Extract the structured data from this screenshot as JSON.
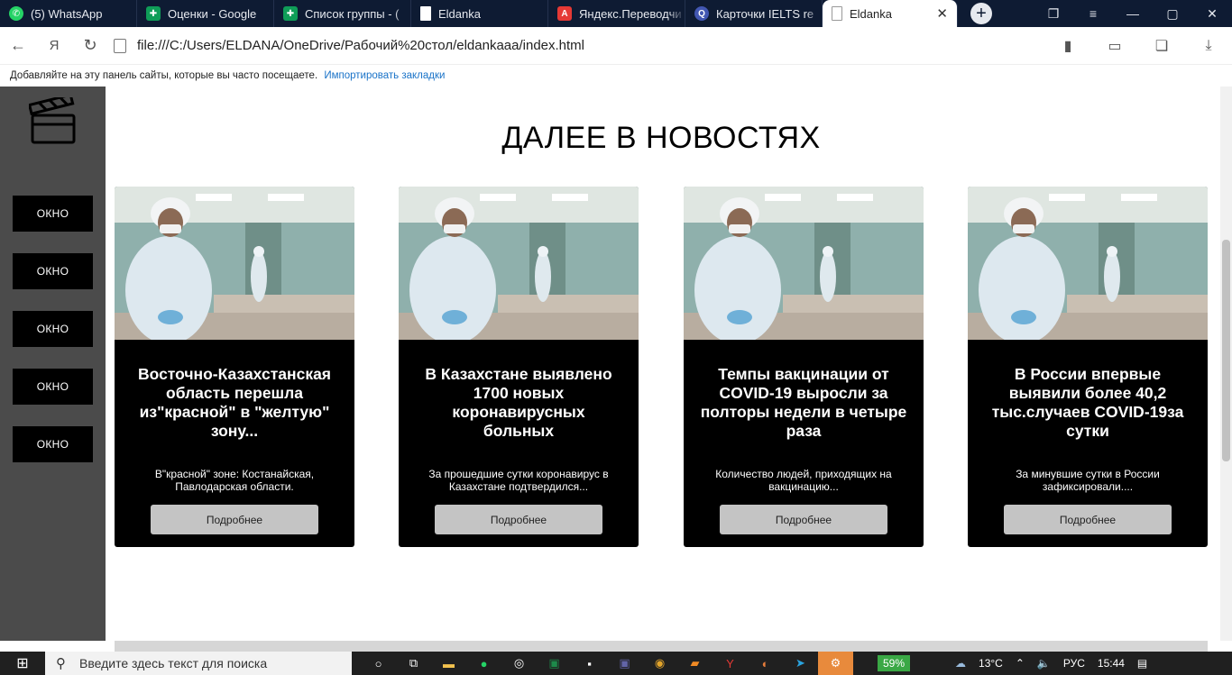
{
  "browser": {
    "tabs": [
      {
        "label": "(5) WhatsApp",
        "icon": "whatsapp-icon",
        "color": "#25d366"
      },
      {
        "label": "Оценки - Google",
        "icon": "sheets-icon",
        "color": "#0f9d58"
      },
      {
        "label": "Список группы - (",
        "icon": "sheets-icon",
        "color": "#0f9d58"
      },
      {
        "label": "Eldanka",
        "icon": "file-icon",
        "color": "#ffffff"
      },
      {
        "label": "Яндекс.Переводчи",
        "icon": "yandex-translate-icon",
        "color": "#e53935"
      },
      {
        "label": "Карточки IELTS re",
        "icon": "quizlet-icon",
        "color": "#4257b2"
      },
      {
        "label": "Eldanka",
        "icon": "file-icon",
        "color": "#ffffff",
        "active": true
      }
    ],
    "url": "file:///C:/Users/ELDANA/OneDrive/Рабочий%20стол/eldankaaa/index.html",
    "bookmarks_hint": "Добавляйте на эту панель сайты, которые вы часто посещаете.",
    "bookmarks_import": "Импортировать закладки"
  },
  "sidebar": {
    "logo": "clapperboard-icon",
    "buttons": [
      "ОКНО",
      "ОКНО",
      "ОКНО",
      "ОКНО",
      "ОКНО"
    ]
  },
  "news": {
    "heading": "ДАЛЕЕ В НОВОСТЯХ",
    "cards": [
      {
        "title": "Восточно-Казахстанская область перешла из\"красной\" в \"желтую\" зону...",
        "desc": "В\"красной\" зоне: Костанайская, Павлодарская области.",
        "button": "Подробнее"
      },
      {
        "title": "В Казахстане выявлено 1700 новых коронавирусных больных",
        "desc": "За прошедшие сутки коронавирус в Казахстане подтвердился...",
        "button": "Подробнее"
      },
      {
        "title": "Темпы вакцинации от COVID-19 выросли за полторы недели в четыре раза",
        "desc": "Количество людей, приходящих на вакцинацию...",
        "button": "Подробнее"
      },
      {
        "title": "В России впервые выявили более 40,2 тыс.случаев COVID-19за сутки",
        "desc": "За минувшие сутки в России зафиксировали....",
        "button": "Подробнее"
      }
    ]
  },
  "taskbar": {
    "search_placeholder": "Введите здесь текст для поиска",
    "battery": "59%",
    "temperature": "13°C",
    "lang": "РУС",
    "time": "15:44"
  }
}
